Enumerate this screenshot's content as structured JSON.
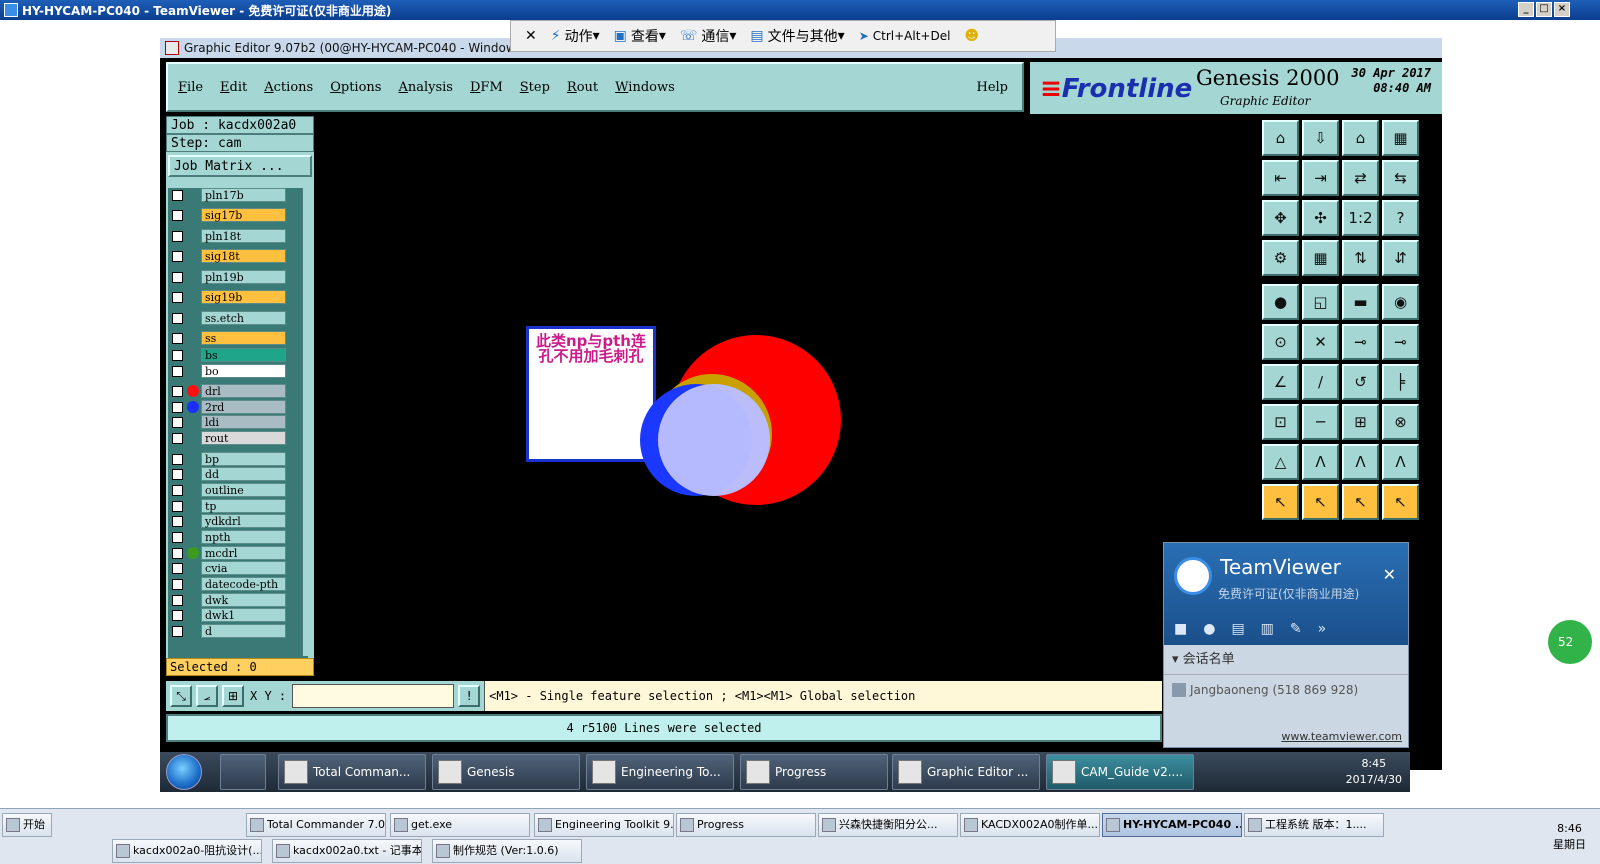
{
  "outer_window": {
    "title": "HY-HYCAM-PC040 - TeamViewer - 免费许可证(仅非商业用途)"
  },
  "teamviewer_toolbar": {
    "items": [
      "动作",
      "查看",
      "通信",
      "文件与其他",
      "Ctrl+Alt+Del"
    ]
  },
  "genesis": {
    "window_title": "Graphic Editor 9.07b2 (00@HY-HYCAM-PC040 - Windows",
    "menu": [
      "File",
      "Edit",
      "Actions",
      "Options",
      "Analysis",
      "DFM",
      "Step",
      "Rout",
      "Windows"
    ],
    "help": "Help",
    "brand": {
      "logo": "Frontline",
      "product": "Genesis 2000",
      "subtitle": "Graphic Editor",
      "date_line1": "30 Apr 2017",
      "date_line2": "08:40 AM"
    },
    "job": "Job : kacdx002a0",
    "step": "Step: cam",
    "job_matrix": "Job Matrix ...",
    "layers": [
      {
        "name": "pln17b",
        "color": "#a4d6d3",
        "dot": ""
      },
      {
        "name": "sig17b",
        "color": "#ffc040",
        "dot": ""
      },
      {
        "name": "pln18t",
        "color": "#a4d6d3",
        "dot": ""
      },
      {
        "name": "sig18t",
        "color": "#ffc040",
        "dot": ""
      },
      {
        "name": "pln19b",
        "color": "#a4d6d3",
        "dot": ""
      },
      {
        "name": "sig19b",
        "color": "#ffc040",
        "dot": ""
      },
      {
        "name": "ss.etch",
        "color": "#a4d6d3",
        "dot": ""
      },
      {
        "name": "ss",
        "color": "#ffc040",
        "dot": ""
      },
      {
        "name": "bs",
        "color": "#1fa58a",
        "dot": ""
      },
      {
        "name": "bo",
        "color": "#ffffff",
        "dot": ""
      },
      {
        "name": "drl",
        "color": "#a9bcc3",
        "dot": "#ff1010"
      },
      {
        "name": "2rd",
        "color": "#a9bcc3",
        "dot": "#1a2fff"
      },
      {
        "name": "ldi",
        "color": "#a9bcc3",
        "dot": ""
      },
      {
        "name": "rout",
        "color": "#d9d9d9",
        "dot": ""
      },
      {
        "name": "bp",
        "color": "#a4d6d3",
        "dot": ""
      },
      {
        "name": "dd",
        "color": "#a4d6d3",
        "dot": ""
      },
      {
        "name": "outline",
        "color": "#a4d6d3",
        "dot": ""
      },
      {
        "name": "tp",
        "color": "#a4d6d3",
        "dot": ""
      },
      {
        "name": "ydkdrl",
        "color": "#a4d6d3",
        "dot": ""
      },
      {
        "name": "npth",
        "color": "#a4d6d3",
        "dot": ""
      },
      {
        "name": "mcdrl",
        "color": "#a4d6d3",
        "dot": "#3c9a1e"
      },
      {
        "name": "cvia",
        "color": "#a4d6d3",
        "dot": ""
      },
      {
        "name": "datecode-pth",
        "color": "#a4d6d3",
        "dot": ""
      },
      {
        "name": "dwk",
        "color": "#a4d6d3",
        "dot": ""
      },
      {
        "name": "dwk1",
        "color": "#a4d6d3",
        "dot": ""
      },
      {
        "name": "d",
        "color": "#a4d6d3",
        "dot": ""
      }
    ],
    "selected": "Selected : 0",
    "note": "此类np与pth连孔不用加毛刺孔",
    "xy_label": "X Y :",
    "xy_value": "",
    "hint": "<M1> - Single feature selection ; <M1><M1> Global selection",
    "status": "4 r5100 Lines were selected"
  },
  "remote_taskbar": {
    "buttons": [
      "Total Comman...",
      "Genesis",
      "Engineering To...",
      "Progress",
      "Graphic Editor ...",
      "CAM_Guide v2...."
    ],
    "time": "8:45",
    "date": "2017/4/30"
  },
  "teamviewer_panel": {
    "brand": "TeamViewer",
    "license": "免费许可证(仅非商业用途)",
    "section": "会话名单",
    "user": "Jangbaoneng (518 869 928)",
    "link": "www.teamviewer.com"
  },
  "side_badge": "52",
  "local_taskbar": {
    "start": "开始",
    "buttons": [
      "Total Commander 7.0...",
      "get.exe",
      "Engineering Toolkit 9....",
      "Progress",
      "兴森快捷衡阳分公...",
      "KACDX002A0制作单...",
      "HY-HYCAM-PC040 ...",
      "工程系统   版本：1...."
    ],
    "row2": [
      "kacdx002a0-阻抗设计(...",
      "kacdx002a0.txt - 记事本",
      "制作规范 (Ver:1.0.6)"
    ],
    "time": "8:46",
    "day": "星期日"
  }
}
